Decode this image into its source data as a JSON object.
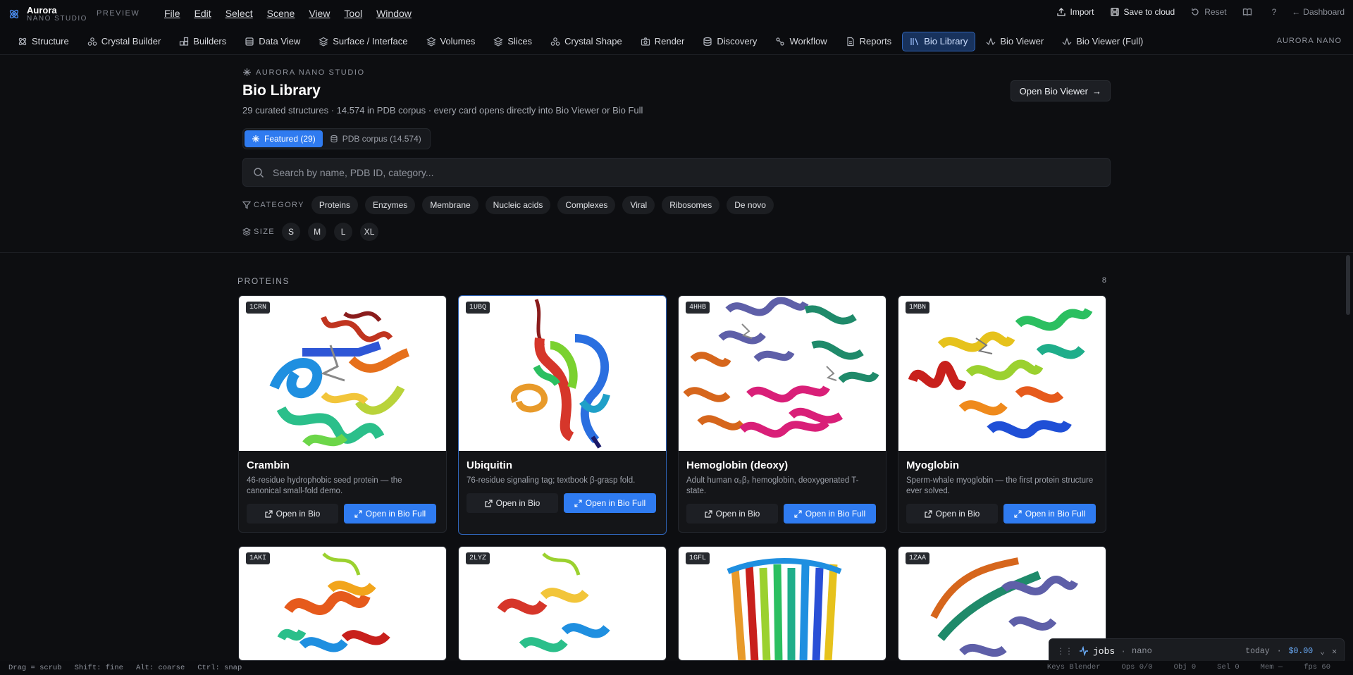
{
  "app": {
    "name": "Aurora",
    "subtitle": "NANO STUDIO",
    "preview": "PREVIEW"
  },
  "menu": [
    "File",
    "Edit",
    "Select",
    "Scene",
    "View",
    "Tool",
    "Window"
  ],
  "toolbar": {
    "import": "Import",
    "save": "Save to cloud",
    "reset": "Reset",
    "help": "?",
    "dashboard": "Dashboard"
  },
  "tabs": [
    "Structure",
    "Crystal Builder",
    "Builders",
    "Data View",
    "Surface / Interface",
    "Volumes",
    "Slices",
    "Crystal Shape",
    "Render",
    "Discovery",
    "Workflow",
    "Reports",
    "Bio Library",
    "Bio Viewer",
    "Bio Viewer (Full)"
  ],
  "tabs_right": "AURORA NANO",
  "header": {
    "kicker": "AURORA NANO STUDIO",
    "title": "Bio Library",
    "subtitle": "29 curated structures · 14.574 in PDB corpus · every card opens directly into Bio Viewer or Bio Full",
    "open_btn": "Open Bio Viewer"
  },
  "segment": {
    "featured": "Featured (29)",
    "corpus": "PDB corpus (14.574)"
  },
  "search": {
    "placeholder": "Search by name, PDB ID, category..."
  },
  "filters": {
    "category_label": "CATEGORY",
    "categories": [
      "Proteins",
      "Enzymes",
      "Membrane",
      "Nucleic acids",
      "Complexes",
      "Viral",
      "Ribosomes",
      "De novo"
    ],
    "size_label": "SIZE",
    "sizes": [
      "S",
      "M",
      "L",
      "XL"
    ]
  },
  "section": {
    "title": "PROTEINS",
    "count": "8"
  },
  "buttons": {
    "open_bio": "Open in Bio",
    "open_full": "Open in Bio Full"
  },
  "cards": [
    {
      "id": "1CRN",
      "name": "Crambin",
      "desc": "46-residue hydrophobic seed protein — the canonical small-fold demo."
    },
    {
      "id": "1UBQ",
      "name": "Ubiquitin",
      "desc": "76-residue signaling tag; textbook β-grasp fold."
    },
    {
      "id": "4HHB",
      "name": "Hemoglobin (deoxy)",
      "desc": "Adult human α₂β₂ hemoglobin, deoxygenated T-state."
    },
    {
      "id": "1MBN",
      "name": "Myoglobin",
      "desc": "Sperm-whale myoglobin — the first protein structure ever solved."
    },
    {
      "id": "1AKI"
    },
    {
      "id": "2LYZ"
    },
    {
      "id": "1GFL"
    },
    {
      "id": "1ZAA"
    }
  ],
  "status": {
    "hints": [
      "Drag = scrub",
      "Shift: fine",
      "Alt: coarse",
      "Ctrl: snap"
    ],
    "right": [
      "Keys Blender",
      "Ops 0/0",
      "Obj 0",
      "Sel 0",
      "Mem —",
      "fps 60"
    ]
  },
  "jobs": {
    "title": "jobs",
    "project": "nano",
    "period": "today",
    "cost": "$0.00"
  }
}
